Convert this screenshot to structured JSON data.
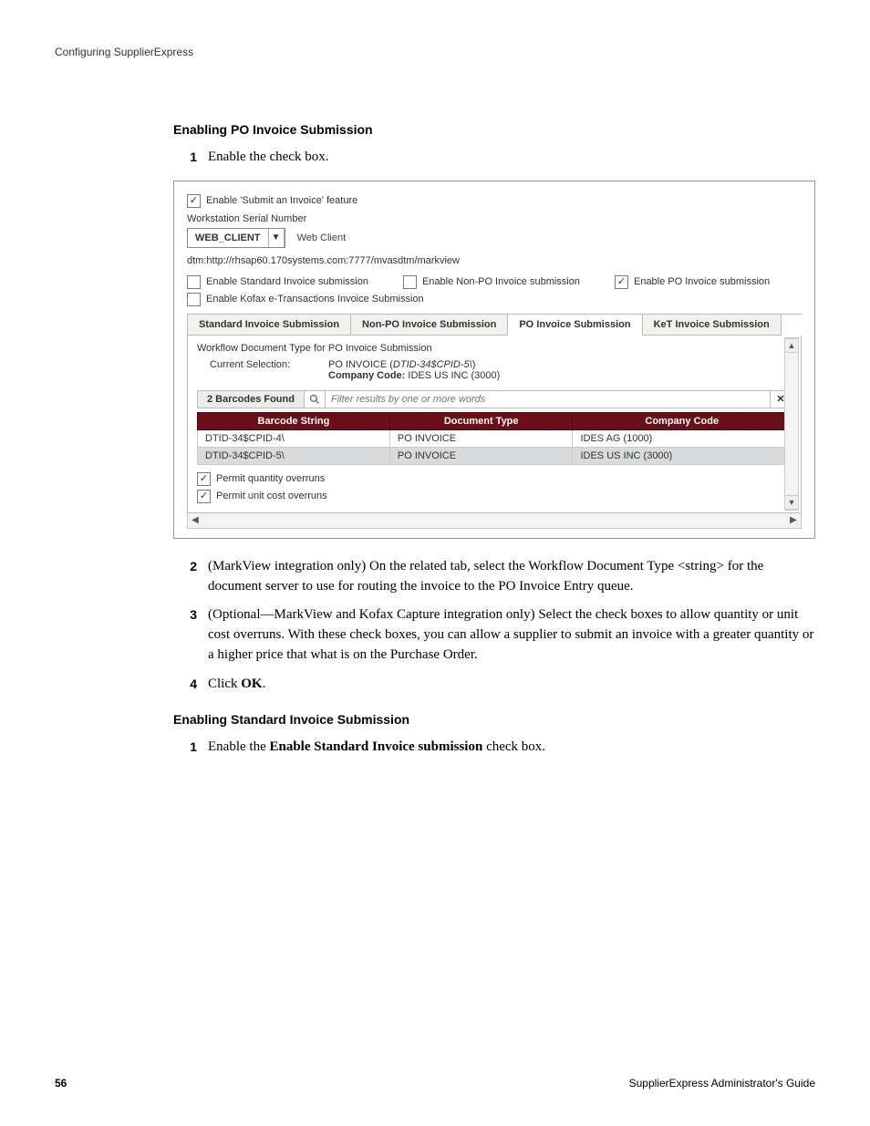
{
  "running_head": "Configuring SupplierExpress",
  "section1": {
    "title": "Enabling PO Invoice Submission",
    "steps": {
      "s1": "Enable the check box.",
      "s2": "(MarkView integration only) On the related tab, select the Workflow Document Type <string> for the document server to use for routing the invoice to the PO Invoice Entry queue.",
      "s3": "(Optional—MarkView and Kofax Capture integration only) Select the check boxes to allow quantity or unit cost overruns. With these check boxes, you can allow a supplier to submit an invoice with a greater quantity or a higher price that what is on the Purchase Order.",
      "s4_pre": "Click ",
      "s4_bold": "OK",
      "s4_post": "."
    }
  },
  "shot": {
    "enable_feature": "Enable 'Submit an Invoice' feature",
    "ws_label": "Workstation Serial Number",
    "ws_value": "WEB_CLIENT",
    "ws_desc": "Web Client",
    "dtm_url": "dtm:http://rhsap60.170systems.com:7777/mvasdtm/markview",
    "checks": {
      "std": "Enable Standard Invoice submission",
      "nonpo": "Enable Non-PO Invoice submission",
      "po": "Enable PO Invoice submission",
      "kofax": "Enable Kofax e-Transactions Invoice Submission"
    },
    "tabs": {
      "std": "Standard Invoice Submission",
      "nonpo": "Non-PO Invoice Submission",
      "po": "PO Invoice Submission",
      "ket": "KeT Invoice Submission"
    },
    "tabbody": {
      "wf_label": "Workflow Document Type for PO Invoice Submission",
      "cur_label": "Current Selection:",
      "cur_line1_a": "PO INVOICE (",
      "cur_line1_b": "DTID-34$CPID-5\\",
      "cur_line1_c": ")",
      "cur_line2_a": "Company Code:",
      "cur_line2_b": " IDES US INC (3000)",
      "barcodes_found": "2 Barcodes Found",
      "filter_placeholder": "Filter results by one or more words",
      "columns": {
        "c1": "Barcode String",
        "c2": "Document Type",
        "c3": "Company Code"
      },
      "rows": [
        {
          "barcode": "DTID-34$CPID-4\\",
          "doctype": "PO INVOICE",
          "cc": "IDES AG (1000)"
        },
        {
          "barcode": "DTID-34$CPID-5\\",
          "doctype": "PO INVOICE",
          "cc": "IDES US INC (3000)"
        }
      ],
      "overrun_qty": "Permit quantity overruns",
      "overrun_cost": "Permit unit cost overruns"
    }
  },
  "section2": {
    "title": "Enabling Standard Invoice Submission",
    "s1_pre": "Enable the ",
    "s1_bold": "Enable Standard Invoice submission",
    "s1_post": " check box."
  },
  "footer": {
    "page": "56",
    "guide": "SupplierExpress Administrator's Guide"
  },
  "chart_data": {
    "type": "table",
    "title": "Workflow Document Type for PO Invoice Submission — barcodes",
    "columns": [
      "Barcode String",
      "Document Type",
      "Company Code"
    ],
    "rows": [
      [
        "DTID-34$CPID-4\\",
        "PO INVOICE",
        "IDES AG (1000)"
      ],
      [
        "DTID-34$CPID-5\\",
        "PO INVOICE",
        "IDES US INC (3000)"
      ]
    ]
  }
}
